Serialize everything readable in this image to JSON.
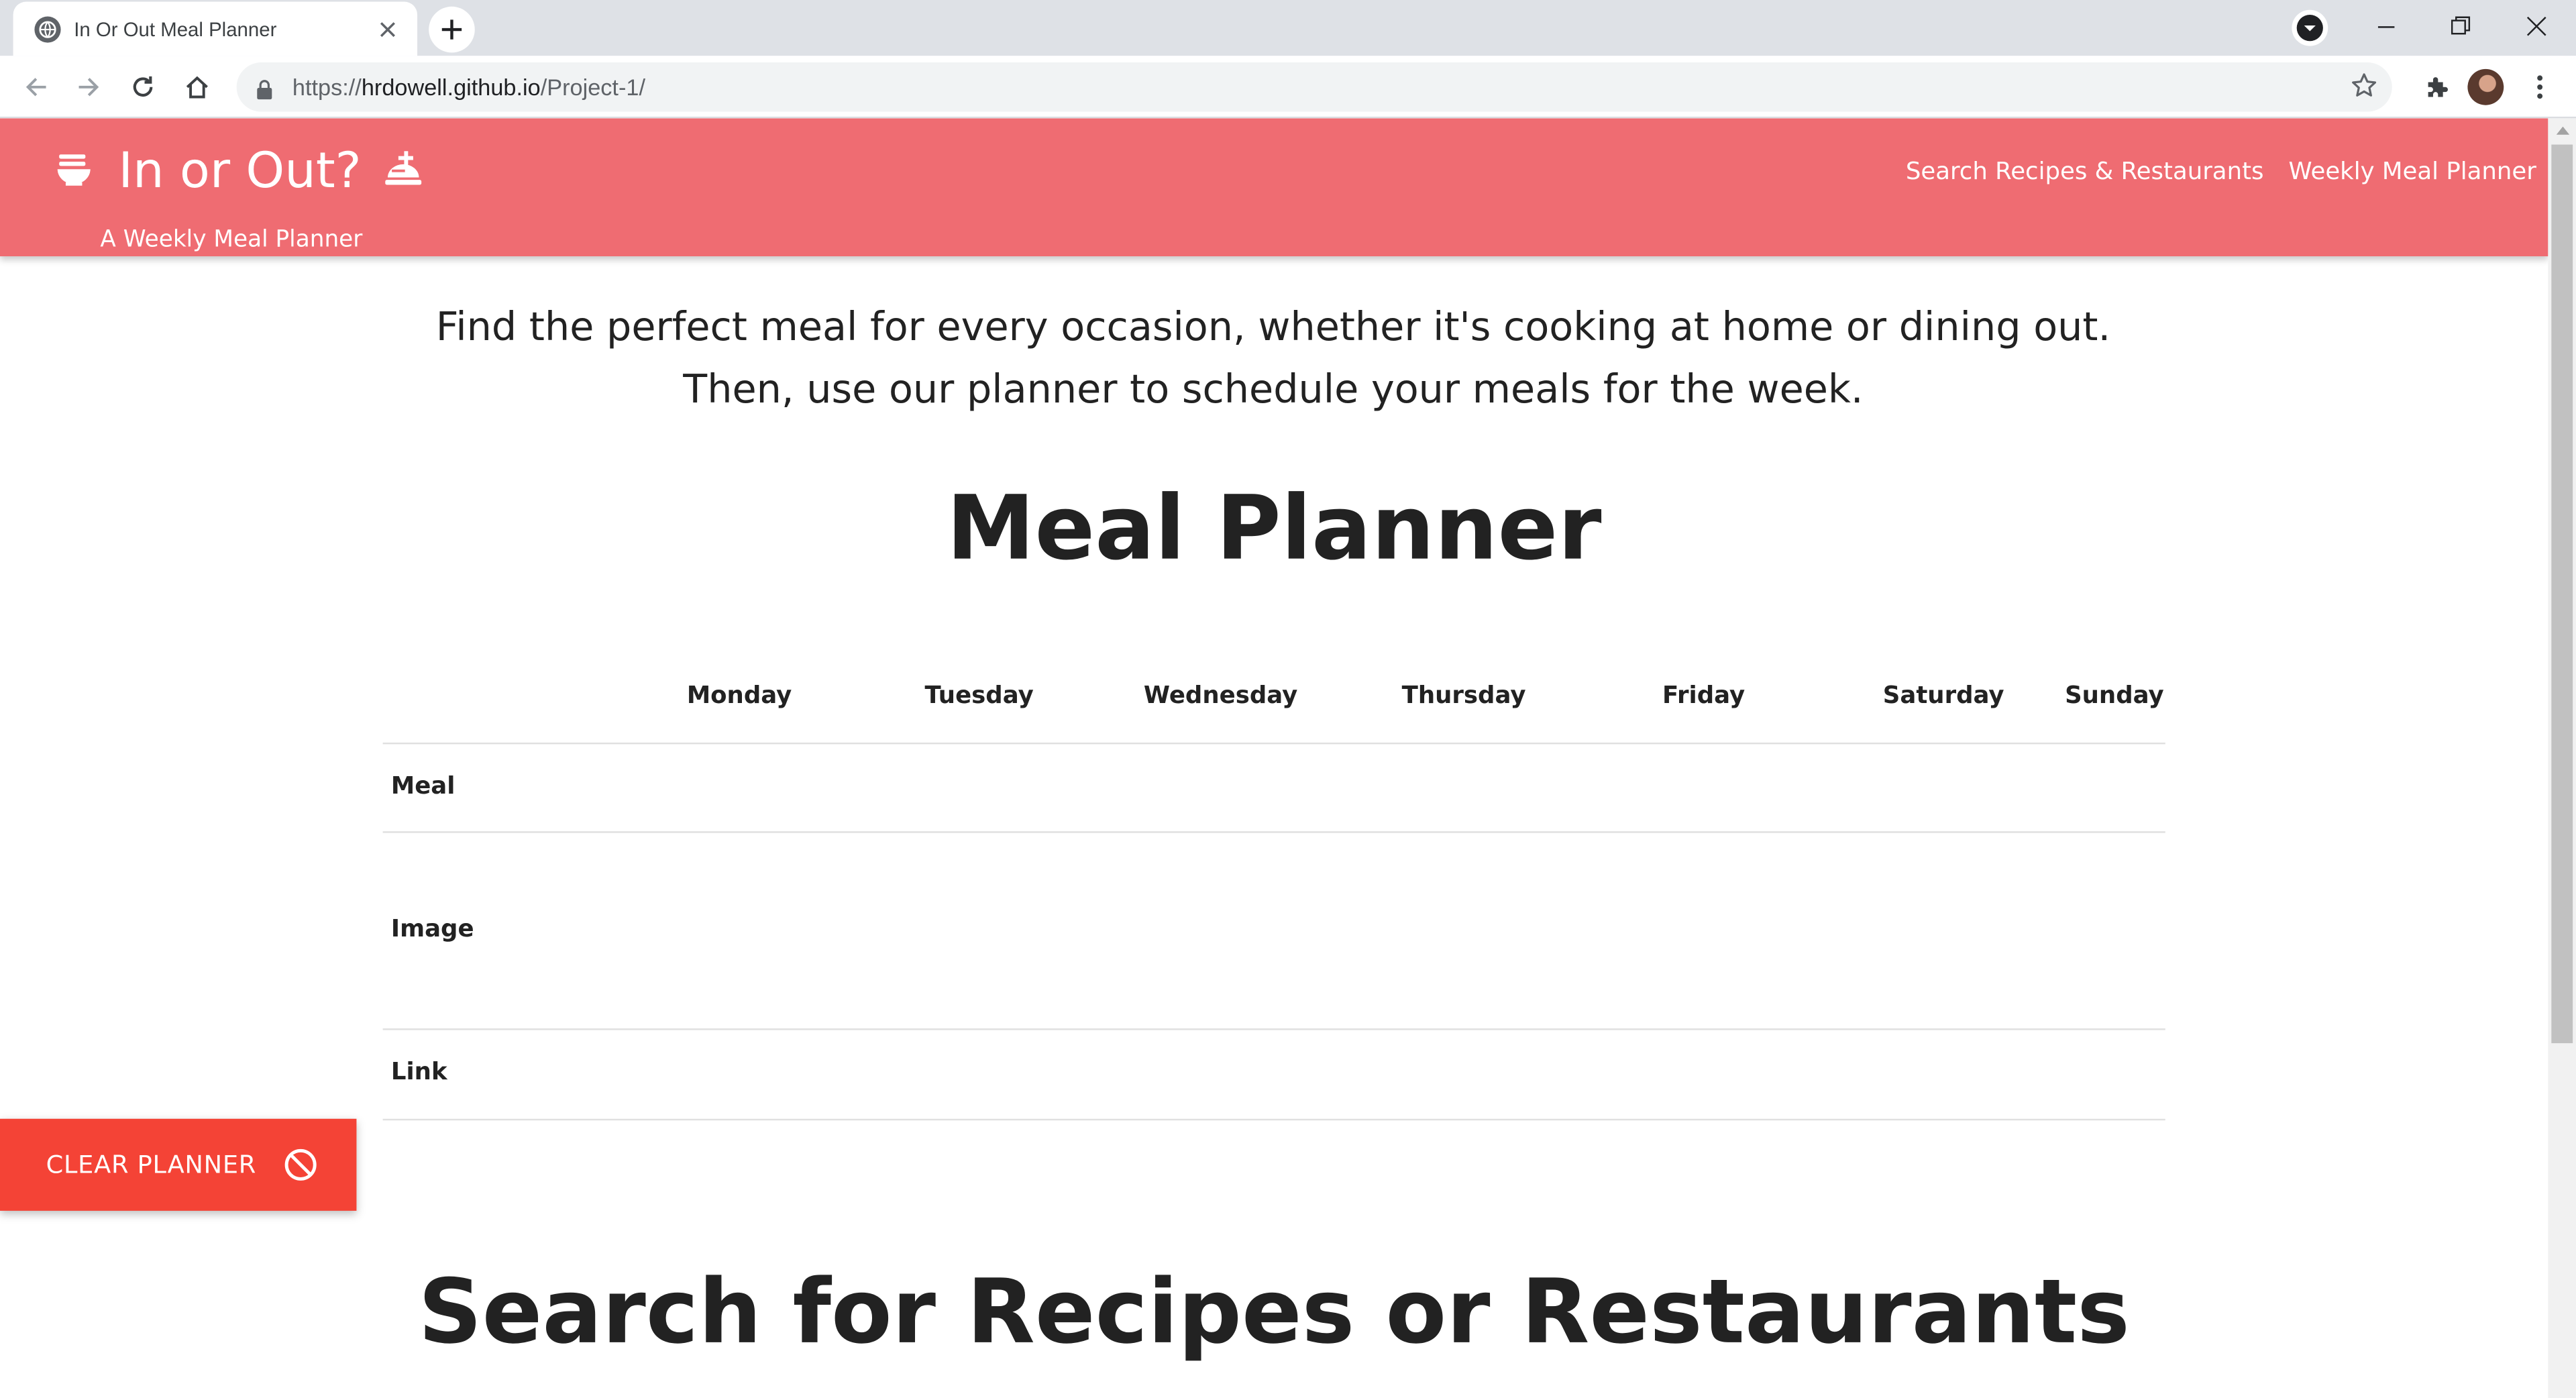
{
  "browser": {
    "tab_title": "In Or Out Meal Planner",
    "url_scheme": "https://",
    "url_host": "hrdowell.github.io",
    "url_path": "/Project-1/"
  },
  "header": {
    "title": "In or Out?",
    "subtitle": "A Weekly Meal Planner",
    "nav": [
      "Search Recipes & Restaurants",
      "Weekly Meal Planner"
    ]
  },
  "intro": "Find the perfect meal for every occasion, whether it's cooking at home or dining out. Then, use our planner to schedule your meals for the week.",
  "planner": {
    "title": "Meal Planner",
    "days": [
      "Monday",
      "Tuesday",
      "Wednesday",
      "Thursday",
      "Friday",
      "Saturday",
      "Sunday"
    ],
    "rows": [
      "Meal",
      "Image",
      "Link"
    ]
  },
  "clear_button": {
    "label": "CLEAR PLANNER",
    "icon": "block-icon",
    "color": "#f44336"
  },
  "search_title": "Search for Recipes or Restaurants",
  "colors": {
    "navbar": "#ef6c72",
    "clear_button": "#f44336"
  }
}
